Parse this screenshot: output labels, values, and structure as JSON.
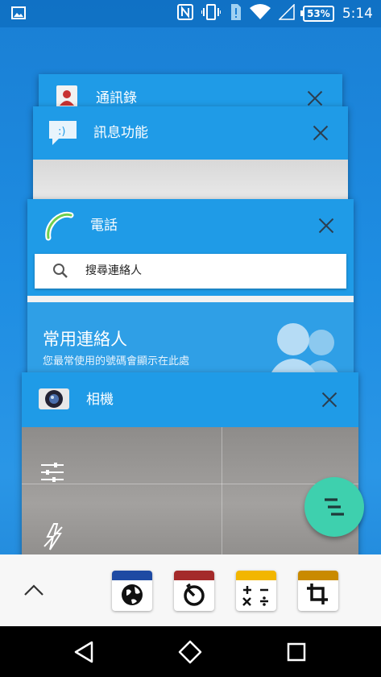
{
  "status_bar": {
    "battery_percent": "53%",
    "time": "5:14"
  },
  "recent_cards": [
    {
      "title": "通訊錄",
      "icon": "contacts-icon"
    },
    {
      "title": "訊息功能",
      "icon": "messaging-icon"
    },
    {
      "title": "電話",
      "icon": "phone-icon",
      "search_placeholder": "搜尋連絡人",
      "favorites_title": "常用連絡人",
      "favorites_subtitle": "您最常使用的號碼會顯示在此處"
    },
    {
      "title": "相機",
      "icon": "camera-icon"
    }
  ],
  "fab": {
    "icon": "clear-all-icon"
  },
  "small_apps": [
    {
      "icon": "browser-globe-icon",
      "color": "#1e4aa3"
    },
    {
      "icon": "timer-icon",
      "color": "#a42a2a"
    },
    {
      "icon": "calculator-icon",
      "color": "#f2b600"
    },
    {
      "icon": "crop-icon",
      "color": "#c98a00"
    }
  ],
  "colors": {
    "card_header": "#1f9be7",
    "fab": "#3ed0ae"
  }
}
